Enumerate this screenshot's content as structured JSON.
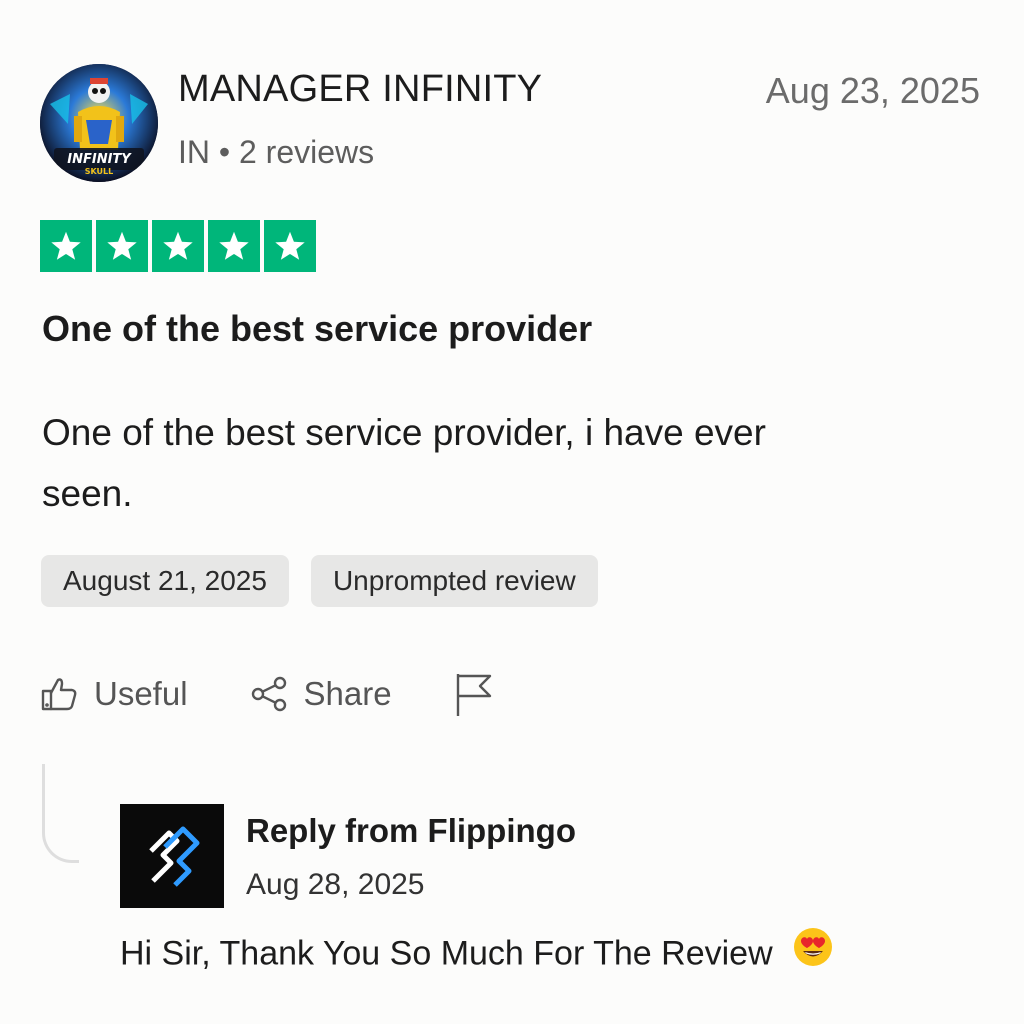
{
  "reviewer": {
    "name": "MANAGER INFINITY",
    "meta": "IN • 2 reviews",
    "avatar_text": "INFINITY SKULL"
  },
  "review": {
    "date": "Aug 23, 2025",
    "rating": 5,
    "max_rating": 5,
    "star_color": "#00b67a",
    "title": "One of the best service provider",
    "body": "One of the best service provider, i have ever seen.",
    "tags": {
      "experience_date": "August 21, 2025",
      "review_type": "Unprompted review"
    }
  },
  "actions": {
    "useful_label": "Useful",
    "share_label": "Share",
    "useful_icon": "thumbs-up-icon",
    "share_icon": "share-icon",
    "report_icon": "flag-icon"
  },
  "reply": {
    "from": "Reply from Flippingo",
    "date": "Aug 28, 2025",
    "text": "Hi Sir, Thank You So Much For The Review",
    "emoji_icon": "heart-eyes-emoji-icon"
  }
}
